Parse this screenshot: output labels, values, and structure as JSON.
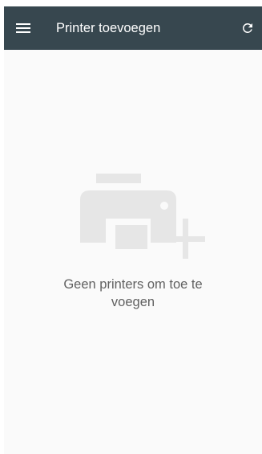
{
  "toolbar": {
    "title": "Printer toevoegen",
    "menu_icon": "hamburger-menu-icon",
    "refresh_icon": "refresh-icon",
    "background": "#37474f"
  },
  "empty_state": {
    "icon": "add-printer-icon",
    "message": "Geen printers om toe te voegen"
  }
}
